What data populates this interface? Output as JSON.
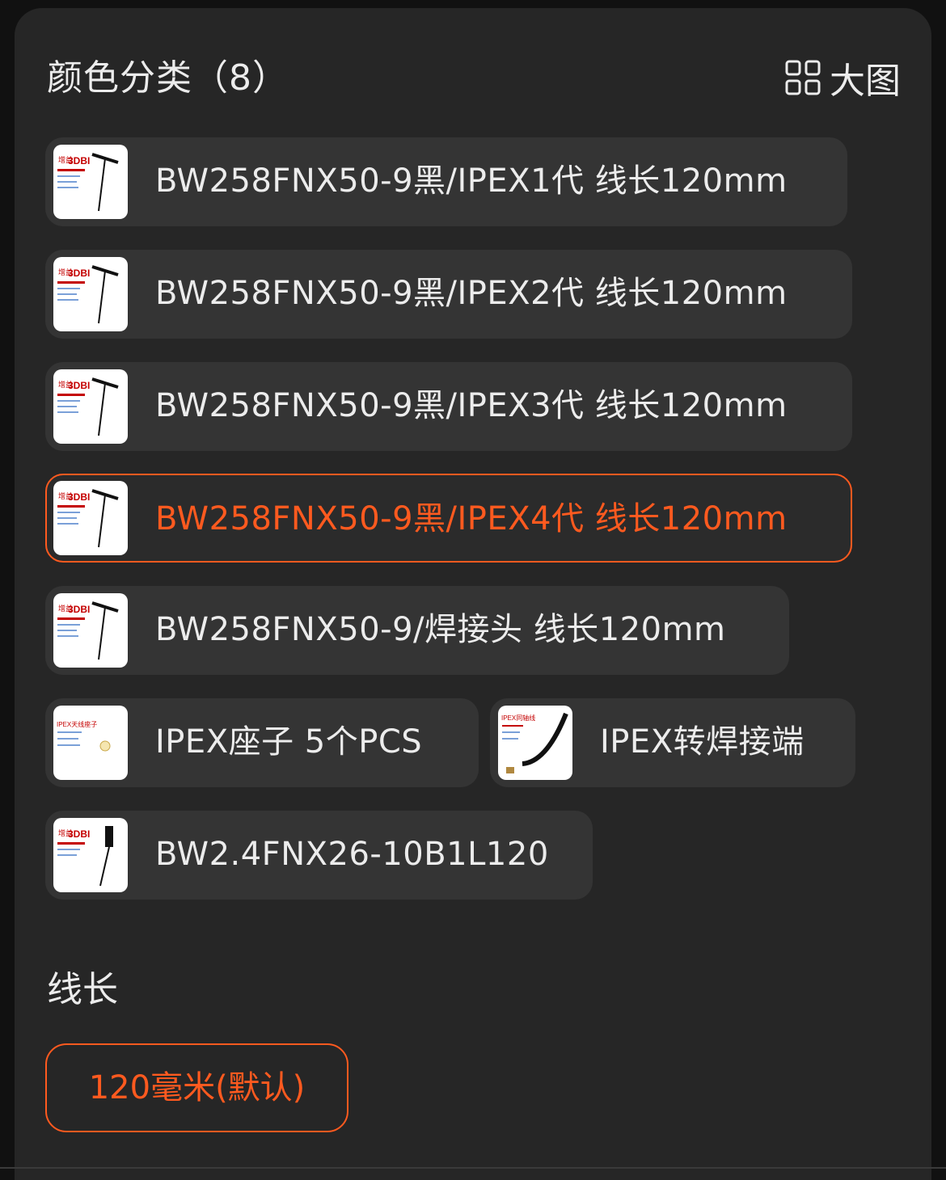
{
  "header": {
    "title": "颜色分类（8）",
    "big_view_label": "大图",
    "big_view_icon": "grid-icon"
  },
  "thumb_texts": {
    "gain": "增益",
    "dbi": "3DBI",
    "ipex_socket": "IPEX天线座子",
    "ipex_adapter": "IPEX同轴线"
  },
  "options": [
    {
      "label": "BW258FNX50-9黑/IPEX1代 线长120mm",
      "selected": false,
      "thumb": "t-antenna"
    },
    {
      "label": "BW258FNX50-9黑/IPEX2代 线长120mm",
      "selected": false,
      "thumb": "t-antenna"
    },
    {
      "label": "BW258FNX50-9黑/IPEX3代 线长120mm",
      "selected": false,
      "thumb": "t-antenna"
    },
    {
      "label": "BW258FNX50-9黑/IPEX4代 线长120mm",
      "selected": true,
      "thumb": "t-antenna"
    },
    {
      "label": "BW258FNX50-9/焊接头 线长120mm",
      "selected": false,
      "thumb": "t-antenna"
    },
    {
      "label": "IPEX座子 5个PCS",
      "selected": false,
      "thumb": "ipex-socket"
    },
    {
      "label": "IPEX转焊接端",
      "selected": false,
      "thumb": "ipex-cable"
    },
    {
      "label": "BW2.4FNX26-10B1L120",
      "selected": false,
      "thumb": "stick-antenna"
    }
  ],
  "length_section": {
    "title": "线长",
    "options": [
      {
        "label": "120毫米(默认)",
        "selected": true
      }
    ]
  },
  "colors": {
    "accent": "#ff5a1f",
    "chip_bg": "#343434",
    "panel_bg": "#262626"
  }
}
